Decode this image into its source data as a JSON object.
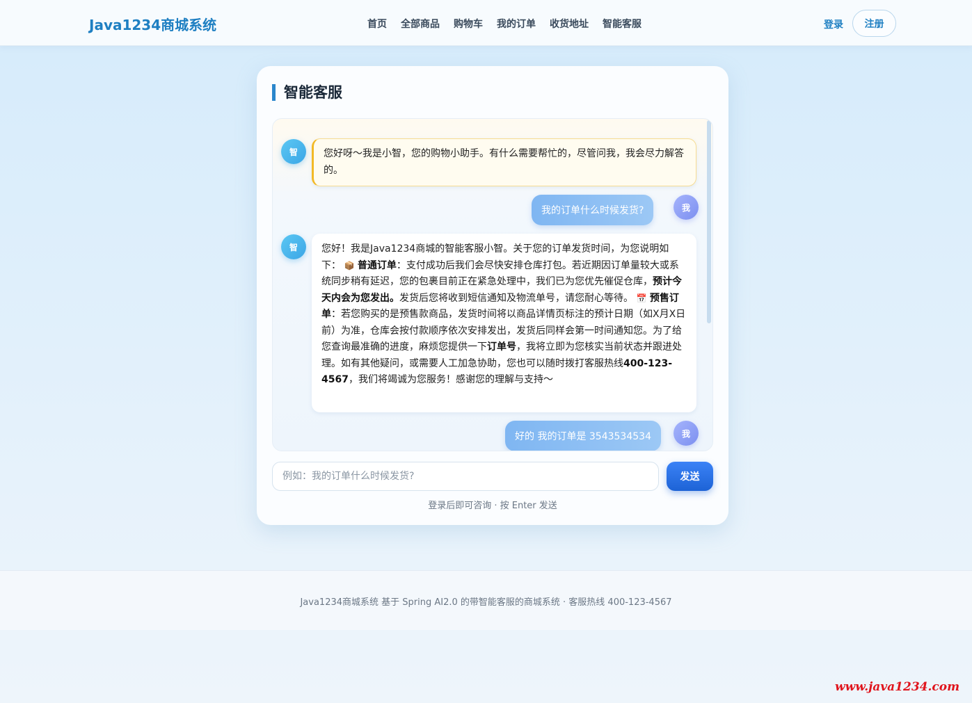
{
  "header": {
    "logo": "Java1234商城系统",
    "nav": [
      "首页",
      "全部商品",
      "购物车",
      "我的订单",
      "收货地址",
      "智能客服"
    ],
    "login_label": "登录",
    "register_label": "注册"
  },
  "chat": {
    "title": "智能客服",
    "bot_avatar": "智",
    "me_avatar": "我",
    "welcome": "您好呀～我是小智，您的购物小助手。有什么需要帮忙的，尽管问我，我会尽力解答的。",
    "user_msg_1": "我的订单什么时候发货?",
    "reply": {
      "t1": "您好！我是Java1234商城的智能客服小智。关于您的订单发货时间，为您说明如下：",
      "icon1": "📦",
      "b1": "普通订单",
      "t2": "：支付成功后我们会尽快安排仓库打包。若近期因订单量较大或系统同步稍有延迟，您的包裹目前正在紧急处理中，我们已为您优先催促仓库，",
      "b2": "预计今天内会为您发出。",
      "t3": "发货后您将收到短信通知及物流单号，请您耐心等待。",
      "icon2": "📅",
      "b3": "预售订单",
      "t4": "：若您购买的是预售款商品，发货时间将以商品详情页标注的预计日期（如X月X日前）为准，仓库会按付款顺序依次安排发出，发货后同样会第一时间通知您。为了给您查询最准确的进度，麻烦您提供一下",
      "b4": "订单号",
      "t5": "，我将立即为您核实当前状态并跟进处理。如有其他疑问，或需要人工加急协助，您也可以随时拨打客服热线",
      "b5": "400-123-4567",
      "t6": "，我们将竭诚为您服务！感谢您的理解与支持～"
    },
    "user_msg_2": "好的 我的订单是 3543534534",
    "input_placeholder": "例如：我的订单什么时候发货?",
    "send_label": "发送",
    "hint": "登录后即可咨询 · 按 Enter 发送"
  },
  "footer": {
    "text": "Java1234商城系统 基于 Spring AI2.0 的带智能客服的商城系统 · 客服热线 400-123-4567"
  },
  "watermark": "www.java1234.com"
}
